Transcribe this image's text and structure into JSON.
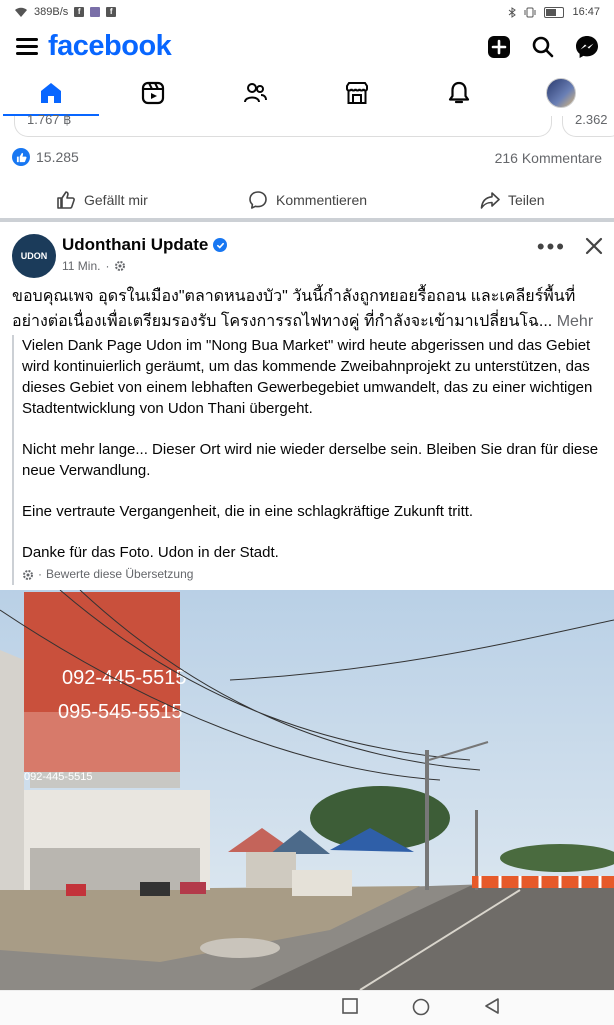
{
  "status_bar": {
    "net_speed": "389B/s",
    "time": "16:47"
  },
  "app": {
    "logo": "facebook"
  },
  "nav": {
    "active_tab": "home"
  },
  "previous_post": {
    "strip_value": "1.767 ฿",
    "strip_value2": "2.362",
    "like_count": "15.285",
    "comments_count": "216 Kommentare",
    "actions": {
      "like": "Gefällt mir",
      "comment": "Kommentieren",
      "share": "Teilen"
    }
  },
  "post": {
    "page_name": "Udonthani Update",
    "avatar_text": "UDON",
    "time": "11 Min.",
    "separator": "·",
    "original_text": "ขอบคุณเพจ อุดรในเมือง\"ตลาดหนองบัว\" วันนี้กำลังถูกทยอยรื้อถอน และเคลียร์พื้นที่อย่างต่อเนื่องเพื่อเตรียมรองรับ โครงการรถไฟทางคู่ ที่กำลังจะเข้ามาเปลี่ยนโฉ...",
    "more_label": "Mehr",
    "translation": [
      "Vielen Dank Page Udon im \"Nong Bua Market\" wird heute abgerissen und das Gebiet wird kontinuierlich geräumt, um das kommende Zweibahnprojekt zu unterstützen, das dieses Gebiet von einem lebhaften Gewerbegebiet umwandelt, das zu einer wichtigen Stadtentwicklung von Udon Thani übergeht.",
      "Nicht mehr lange... Dieser Ort wird nie wieder derselbe sein. Bleiben Sie dran für diese neue Verwandlung.",
      "Eine vertraute Vergangenheit, die in eine schlagkräftige Zukunft tritt.",
      "Danke für das Foto. Udon in der Stadt."
    ],
    "rate_translation": "Bewerte diese Übersetzung",
    "billboard_text": [
      "092-445-5515",
      "095-545-5515",
      "092-445-5515"
    ]
  },
  "colors": {
    "brand": "#0866ff",
    "like": "#1877f2",
    "text": "#050505",
    "muted": "#65676b"
  }
}
